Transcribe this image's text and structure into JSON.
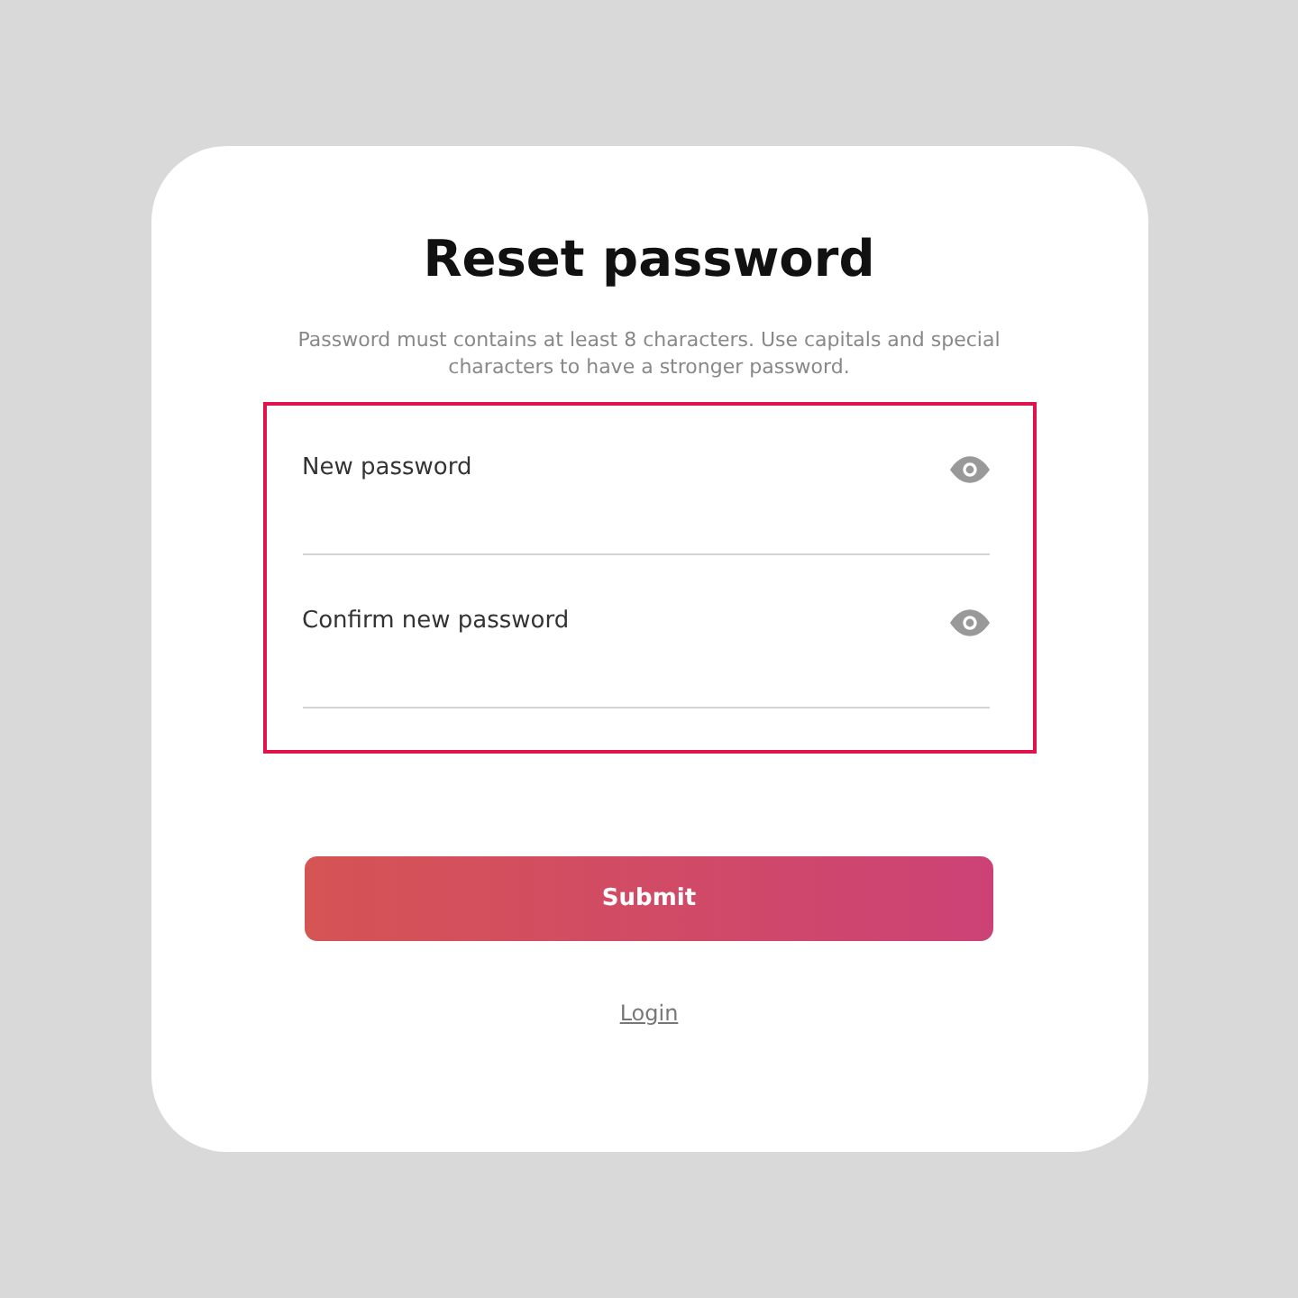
{
  "title": "Reset password",
  "description": "Password must contains at least 8 characters. Use capitals and special characters to have a stronger password.",
  "field_group": {
    "highlighted": true,
    "fields": [
      {
        "placeholder": "New password"
      },
      {
        "placeholder": "Confirm new password"
      }
    ]
  },
  "submit_button": "Submit",
  "login_link": "Login"
}
